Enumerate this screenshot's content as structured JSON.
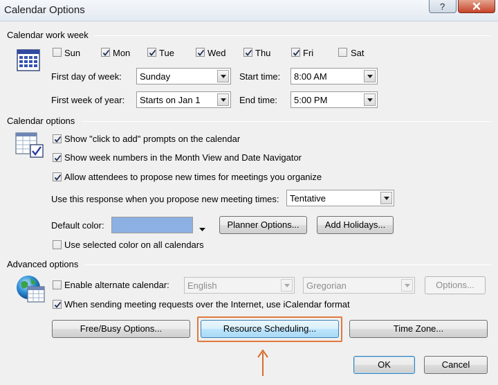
{
  "window": {
    "title": "Calendar Options",
    "help_label": "?",
    "accent_highlight": "#e0783c"
  },
  "work_week": {
    "header": "Calendar work week",
    "days": [
      {
        "label": "Sun",
        "checked": false
      },
      {
        "label": "Mon",
        "checked": true
      },
      {
        "label": "Tue",
        "checked": true
      },
      {
        "label": "Wed",
        "checked": true
      },
      {
        "label": "Thu",
        "checked": true
      },
      {
        "label": "Fri",
        "checked": true
      },
      {
        "label": "Sat",
        "checked": false
      }
    ],
    "first_day_label": "First day of week:",
    "first_day_value": "Sunday",
    "first_week_label": "First week of year:",
    "first_week_value": "Starts on Jan 1",
    "start_time_label": "Start time:",
    "start_time_value": "8:00 AM",
    "end_time_label": "End time:",
    "end_time_value": "5:00 PM"
  },
  "calendar_options": {
    "header": "Calendar options",
    "show_click_to_add": "Show \"click to add\" prompts on the calendar",
    "show_week_numbers": "Show week numbers in the Month View and Date Navigator",
    "allow_propose": "Allow attendees to propose new times for meetings you organize",
    "response_label": "Use this response when you propose new meeting times:",
    "response_value": "Tentative",
    "default_color_label": "Default color:",
    "default_color_value": "#8cb0e2",
    "planner_options": "Planner Options...",
    "add_holidays": "Add Holidays...",
    "use_selected_color": "Use selected color on all calendars"
  },
  "advanced": {
    "header": "Advanced options",
    "enable_alternate": "Enable alternate calendar:",
    "language_value": "English",
    "calendar_type_value": "Gregorian",
    "options_button": "Options...",
    "icalendar_label": "When sending meeting requests over the Internet, use iCalendar format"
  },
  "footer": {
    "free_busy": "Free/Busy Options...",
    "resource_scheduling": "Resource Scheduling...",
    "time_zone": "Time Zone...",
    "ok": "OK",
    "cancel": "Cancel"
  }
}
